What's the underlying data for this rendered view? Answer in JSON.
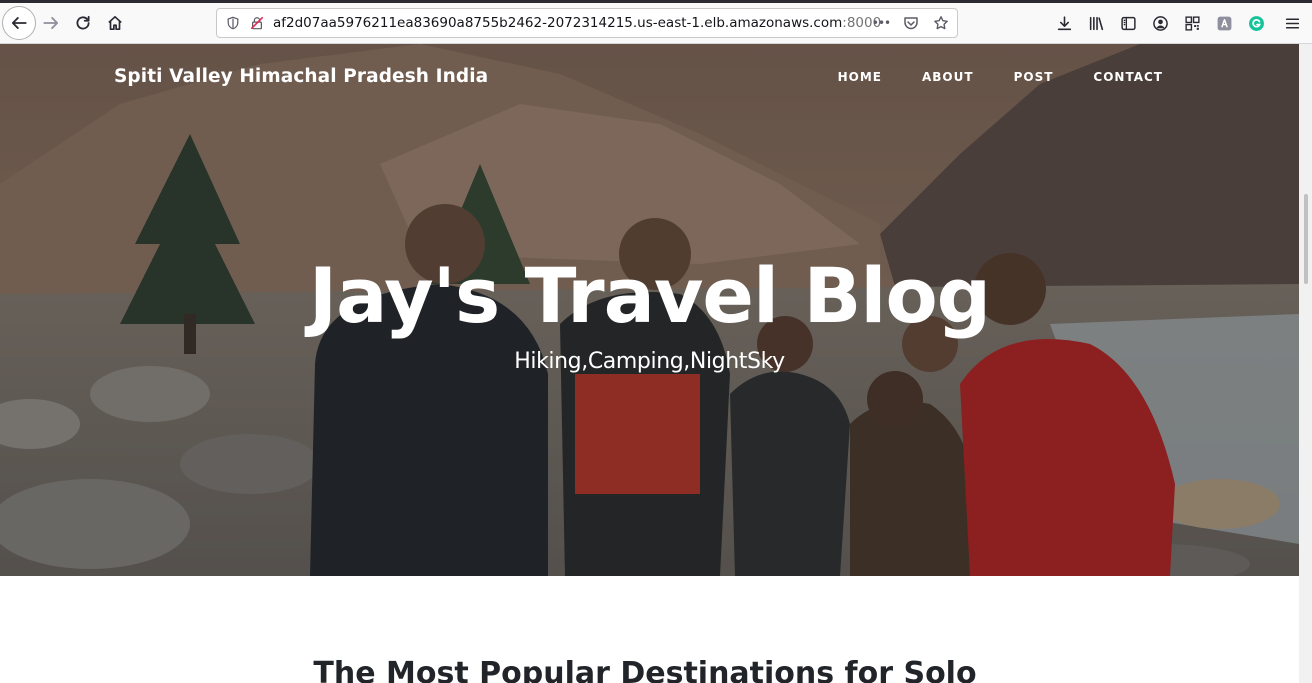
{
  "browser": {
    "url_host": "af2d07aa5976211ea83690a8755b2462-2072314215.us-east-1.elb.amazonaws.com",
    "url_port": ":8000",
    "more_label": "•••",
    "icons": [
      "back-icon",
      "forward-icon",
      "reload-icon",
      "home-icon",
      "shield-icon",
      "insecure-lock-icon",
      "pocket-icon",
      "bookmark-star-icon",
      "download-icon",
      "library-icon",
      "sidebar-icon",
      "account-icon",
      "qr-icon",
      "extension-icon",
      "grammarly-icon",
      "menu-icon"
    ]
  },
  "site": {
    "brand": "Spiti Valley Himachal Pradesh India",
    "nav": [
      "HOME",
      "ABOUT",
      "POST",
      "CONTACT"
    ],
    "hero_title": "Jay's Travel Blog",
    "hero_subtitle": "Hiking,Camping,NightSky",
    "post_heading": "The Most Popular Destinations for Solo"
  },
  "colors": {
    "brand_text": "#ffffff",
    "heading_text": "#212529",
    "overlay": "rgba(33,37,41,0.35)"
  }
}
